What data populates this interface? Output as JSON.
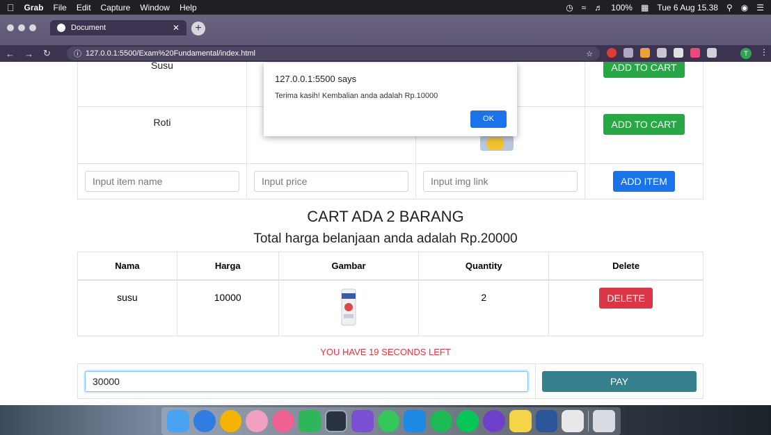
{
  "menubar": {
    "app": "Grab",
    "items": [
      "File",
      "Edit",
      "Capture",
      "Window",
      "Help"
    ],
    "battery": "100%",
    "datetime": "Tue 6 Aug 15.38"
  },
  "browser": {
    "tab_title": "Document",
    "url": "127.0.0.1:5500/Exam%20Fundamental/index.html",
    "profile_initial": "T"
  },
  "items": [
    {
      "name": "Susu",
      "button": "ADD TO CART"
    },
    {
      "name": "Roti",
      "button": "ADD TO CART"
    }
  ],
  "form": {
    "name_placeholder": "Input item name",
    "price_placeholder": "Input price",
    "img_placeholder": "Input img link",
    "add_button": "ADD ITEM"
  },
  "cart": {
    "title": "CART ADA 2 BARANG",
    "total": "Total harga belanjaan anda adalah Rp.20000",
    "columns": [
      "Nama",
      "Harga",
      "Gambar",
      "Quantity",
      "Delete"
    ],
    "rows": [
      {
        "nama": "susu",
        "harga": "10000",
        "quantity": "2",
        "delete": "DELETE"
      }
    ]
  },
  "timer": "YOU HAVE 19 SECONDS LEFT",
  "payment": {
    "value": "30000",
    "button": "PAY"
  },
  "dialog": {
    "origin": "127.0.0.1:5500 says",
    "message": "Terima kasih! Kembalian anda adalah Rp.10000",
    "ok": "OK"
  },
  "colors": {
    "add_to_cart": "#28a745",
    "add_item": "#1a73e8",
    "delete": "#dc3545",
    "pay": "#34808e",
    "timer": "#dc3545"
  }
}
